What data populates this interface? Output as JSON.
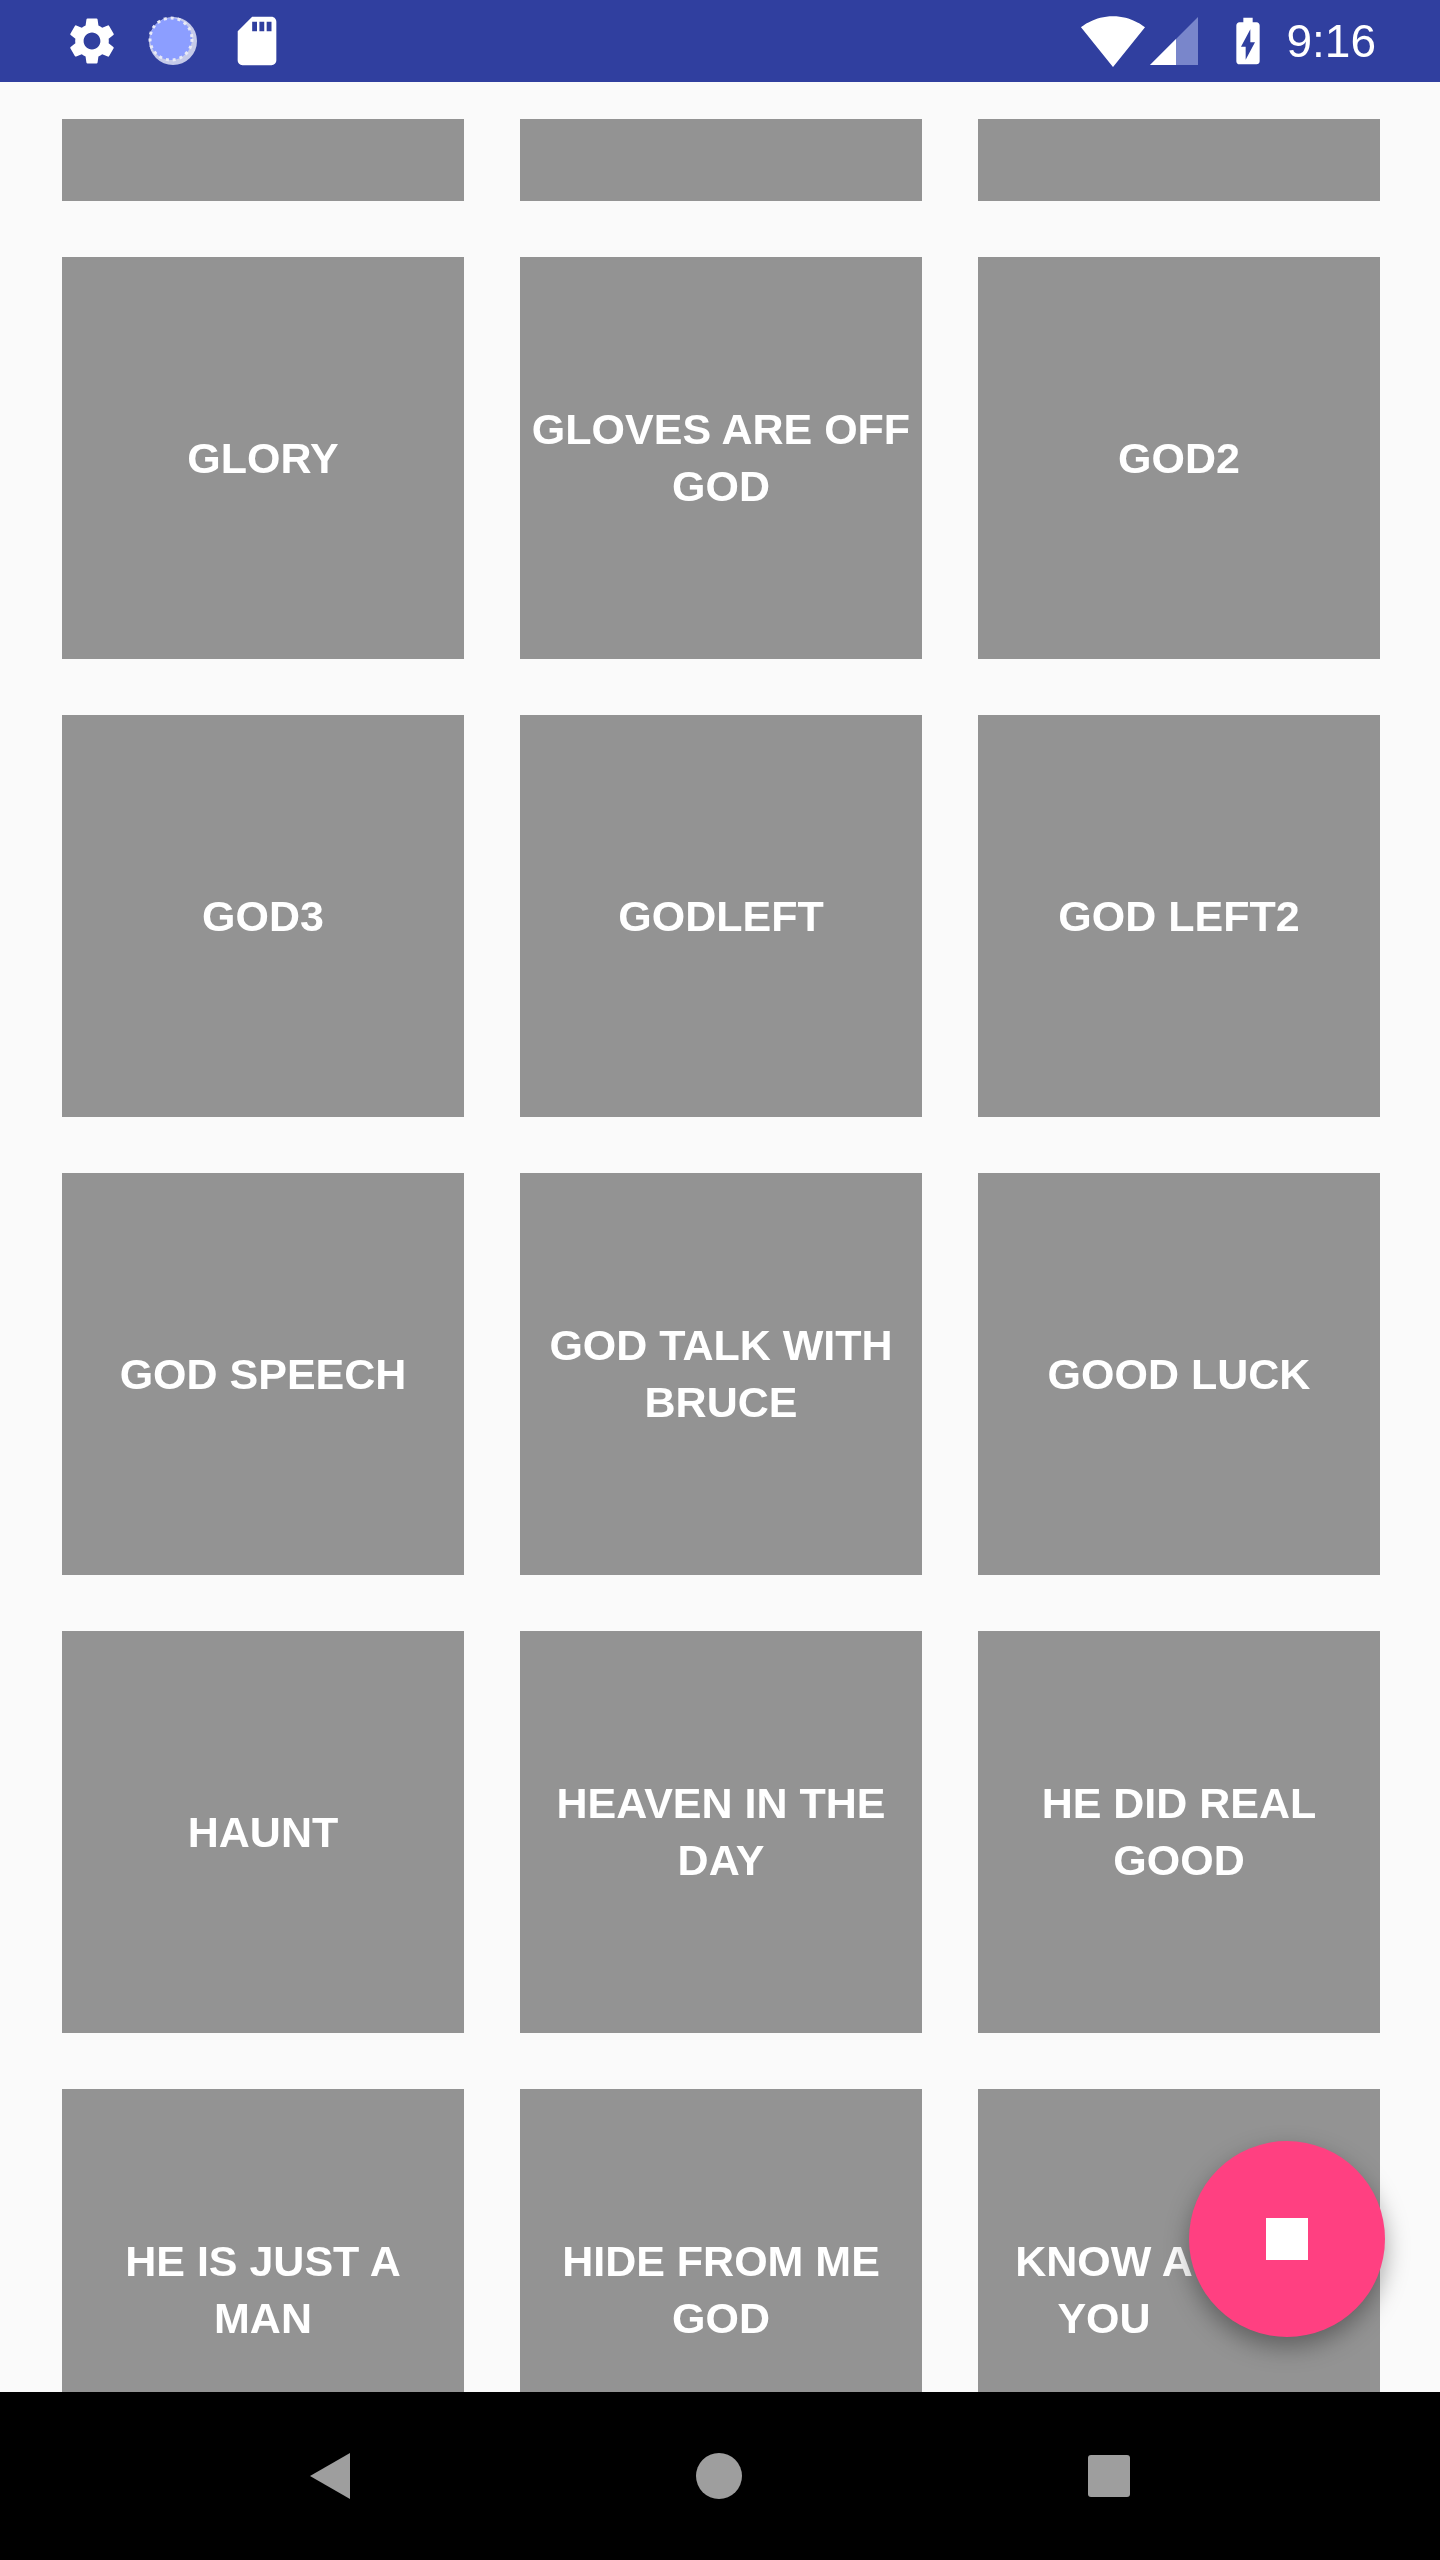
{
  "status_bar": {
    "time": "9:16"
  },
  "tiles": [
    {
      "kind": "partial"
    },
    {
      "kind": "partial"
    },
    {
      "kind": "partial"
    },
    {
      "kind": "sound",
      "lines": [
        "GLORY"
      ],
      "covered": false
    },
    {
      "kind": "sound",
      "lines": [
        "GLOVES ARE OFF",
        "GOD"
      ],
      "covered": false
    },
    {
      "kind": "sound",
      "lines": [
        "GOD2"
      ],
      "covered": false
    },
    {
      "kind": "sound",
      "lines": [
        "GOD3"
      ],
      "covered": false
    },
    {
      "kind": "sound",
      "lines": [
        "GODLEFT"
      ],
      "covered": false
    },
    {
      "kind": "sound",
      "lines": [
        "GOD LEFT2"
      ],
      "covered": false
    },
    {
      "kind": "sound",
      "lines": [
        "GOD SPEECH"
      ],
      "covered": false
    },
    {
      "kind": "sound",
      "lines": [
        "GOD TALK WITH",
        "BRUCE"
      ],
      "covered": false
    },
    {
      "kind": "sound",
      "lines": [
        "GOOD LUCK"
      ],
      "covered": false
    },
    {
      "kind": "sound",
      "lines": [
        "HAUNT"
      ],
      "covered": false
    },
    {
      "kind": "sound",
      "lines": [
        "HEAVEN IN THE",
        "DAY"
      ],
      "covered": false
    },
    {
      "kind": "sound",
      "lines": [
        "HE DID REAL",
        "GOOD"
      ],
      "covered": false
    },
    {
      "kind": "sound",
      "lines": [
        "HE IS JUST A",
        "MAN"
      ],
      "covered": false
    },
    {
      "kind": "sound",
      "lines": [
        "HIDE FROM ME",
        "GOD"
      ],
      "covered": false
    },
    {
      "kind": "sound",
      "lines": [
        "KNOW A",
        "YOU"
      ],
      "covered": true
    }
  ]
}
